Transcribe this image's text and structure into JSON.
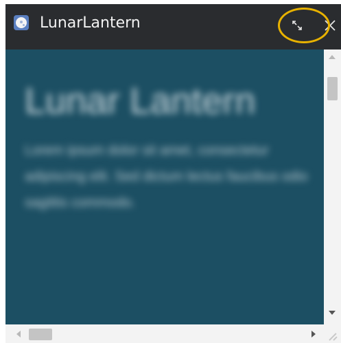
{
  "window": {
    "title": "LunarLantern",
    "app_icon": "moon-icon",
    "controls": {
      "expand_icon": "expand-arrows-icon",
      "close_glyph": "✕"
    },
    "highlight_color": "#e8b200"
  },
  "content": {
    "heading": "Lunar Lantern",
    "body": "Lorem ipsum dolor sit amet, consectetur adipiscing elit. Sed dictum lectus faucibus odio sagittis commodo.",
    "background": "#1c4f63"
  },
  "scrollbars": {
    "vertical": {
      "up_icon": "arrow-up-icon",
      "down_icon": "arrow-down-icon"
    },
    "horizontal": {
      "left_icon": "arrow-left-icon",
      "right_icon": "arrow-right-icon"
    }
  }
}
